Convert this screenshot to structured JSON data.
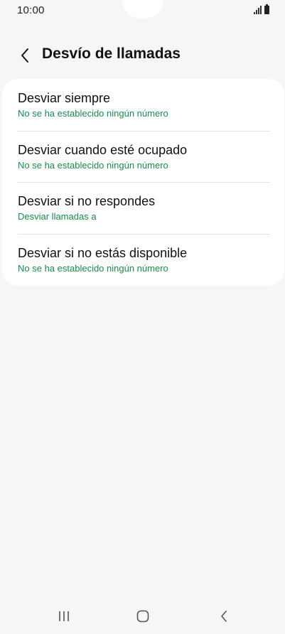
{
  "status_bar": {
    "time": "10:00"
  },
  "header": {
    "title": "Desvío de llamadas",
    "back_icon": "chevron-left-icon"
  },
  "items": [
    {
      "title": "Desviar siempre",
      "subtitle": "No se ha establecido ningún número"
    },
    {
      "title": "Desviar cuando esté ocupado",
      "subtitle": "No se ha establecido ningún número"
    },
    {
      "title": "Desviar si no respondes",
      "subtitle": "Desviar llamadas a"
    },
    {
      "title": "Desviar si no estás disponible",
      "subtitle": "No se ha establecido ningún número"
    }
  ],
  "colors": {
    "subtitle": "#1b8a4a",
    "background": "#f6f6f8",
    "card": "#ffffff"
  },
  "nav_bar": {
    "icons": [
      "recent-apps-icon",
      "home-icon",
      "back-icon"
    ]
  }
}
